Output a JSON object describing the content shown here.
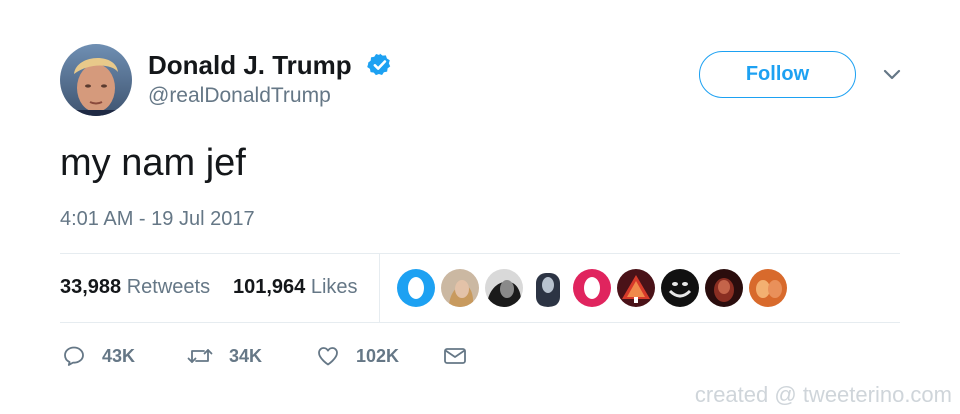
{
  "user": {
    "display_name": "Donald J. Trump",
    "handle": "@realDonaldTrump",
    "verified": true
  },
  "follow_button": {
    "label": "Follow"
  },
  "tweet": {
    "text": "my nam jef",
    "timestamp": "4:01 AM - 19 Jul 2017"
  },
  "stats": {
    "retweets": {
      "count": "33,988",
      "label": "Retweets"
    },
    "likes": {
      "count": "101,964",
      "label": "Likes"
    }
  },
  "likers": [
    "liker-avatar-1",
    "liker-avatar-2",
    "liker-avatar-3",
    "liker-avatar-4",
    "liker-avatar-5",
    "liker-avatar-6",
    "liker-avatar-7",
    "liker-avatar-8",
    "liker-avatar-9"
  ],
  "actions": {
    "reply": {
      "icon": "reply-icon",
      "count": "43K"
    },
    "retweet": {
      "icon": "retweet-icon",
      "count": "34K"
    },
    "like": {
      "icon": "heart-icon",
      "count": "102K"
    },
    "message": {
      "icon": "envelope-icon"
    }
  },
  "watermark": "created @ tweeterino.com",
  "colors": {
    "accent": "#1da1f2",
    "text": "#14171a",
    "muted": "#657786",
    "border": "#e6ecf0",
    "watermark": "#cfd5da"
  }
}
